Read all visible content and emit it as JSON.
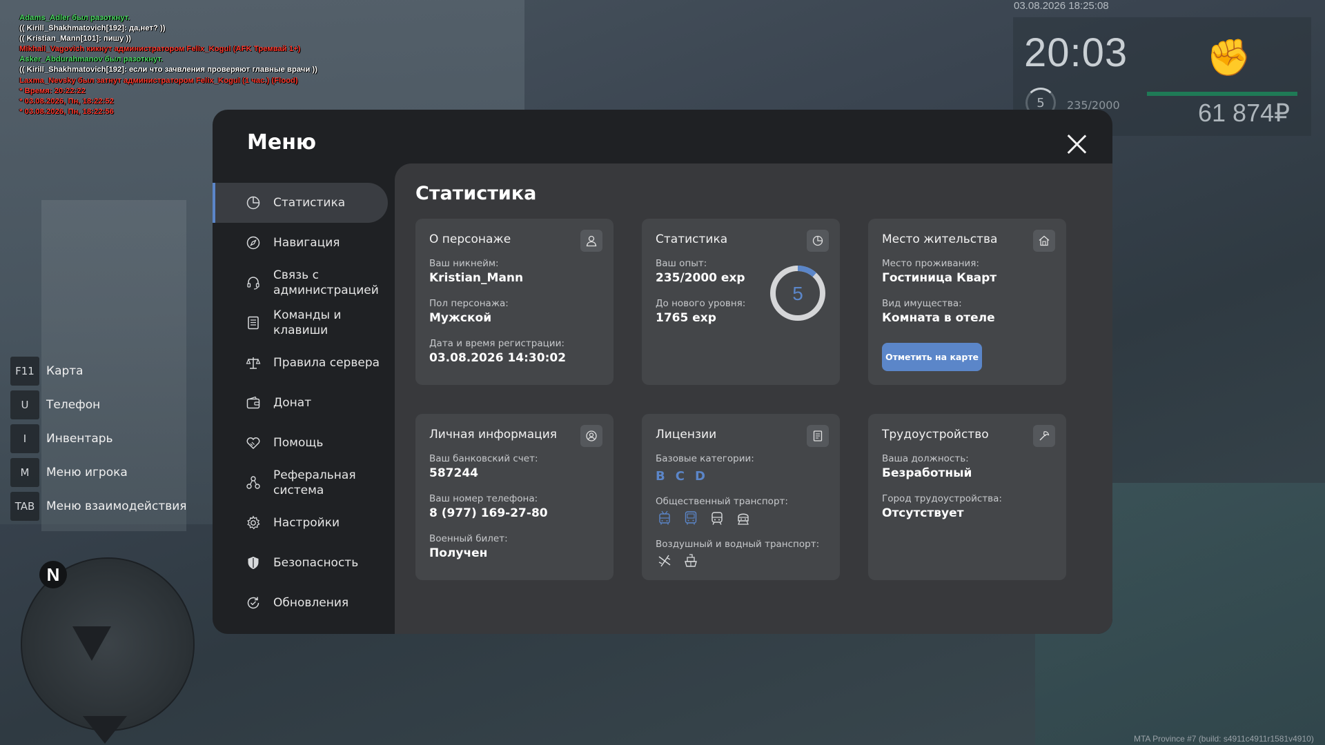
{
  "chat": [
    {
      "text": "Adams_Adler был разоткнут.",
      "color": "#4cd964"
    },
    {
      "text": "(( Kirill_Shakhmatovich[192]: да,нет? ))",
      "color": "#ffffff"
    },
    {
      "text": "(( Kristian_Mann[101]: пишу ))",
      "color": "#ffffff"
    },
    {
      "text": "Mikhail_Vagovich кикнут администратором Felix_Kogul (AFK Тремвай 1+)",
      "color": "#ff3b30"
    },
    {
      "text": "Asker_Abdurahmanov был разоткнут.",
      "color": "#4cd964"
    },
    {
      "text": "(( Kirill_Shakhmatovich[192]: если что зачвления проверяют главные врачи ))",
      "color": "#ffffff"
    },
    {
      "text": "Laxma_Nevsky был затнут администратором Felix_Kogul (1 час.) (Flood)",
      "color": "#ff3b30"
    },
    {
      "text": "* Время: 20:22:22",
      "color": "#ff3b30"
    },
    {
      "text": "* 03.08.2026, Пн, 18:22:52",
      "color": "#ff3b30"
    },
    {
      "text": "* 03.08.2026, Пн, 18:22:56",
      "color": "#ff3b30"
    }
  ],
  "hud": {
    "datetime": "03.08.2026 18:25:08",
    "clock": "20:03",
    "level": "5",
    "exp": "235/2000",
    "money": "61 874₽",
    "fist_icon": "fist-icon"
  },
  "hotkeys": [
    {
      "key": "F11",
      "label": "Карта"
    },
    {
      "key": "U",
      "label": "Телефон"
    },
    {
      "key": "I",
      "label": "Инвентарь"
    },
    {
      "key": "M",
      "label": "Меню игрока"
    },
    {
      "key": "TAB",
      "label": "Меню взаимодействия"
    }
  ],
  "minimap": {
    "north": "N"
  },
  "build": "MTA Province #7 (build: s4911c4911r1581v4910)",
  "menu": {
    "title": "Меню",
    "sidebar": [
      {
        "label": "Статистика",
        "icon": "chart-pie-icon",
        "active": true
      },
      {
        "label": "Навигация",
        "icon": "compass-icon"
      },
      {
        "label": "Связь с администрацией",
        "icon": "headset-icon"
      },
      {
        "label": "Команды и клавиши",
        "icon": "document-list-icon"
      },
      {
        "label": "Правила сервера",
        "icon": "scales-icon"
      },
      {
        "label": "Донат",
        "icon": "wallet-icon"
      },
      {
        "label": "Помощь",
        "icon": "handshake-icon"
      },
      {
        "label": "Реферальная система",
        "icon": "referral-icon"
      },
      {
        "label": "Настройки",
        "icon": "gear-icon"
      },
      {
        "label": "Безопасность",
        "icon": "shield-icon"
      },
      {
        "label": "Обновления",
        "icon": "refresh-icon"
      }
    ],
    "content_title": "Статистика",
    "cards": {
      "character": {
        "title": "О персонаже",
        "nick_label": "Ваш никнейм:",
        "nick": "Kristian_Mann",
        "gender_label": "Пол персонажа:",
        "gender": "Мужской",
        "reg_label": "Дата и время регистрации:",
        "reg": "03.08.2026 14:30:02"
      },
      "stats": {
        "title": "Статистика",
        "exp_label": "Ваш опыт:",
        "exp": "235/2000 exp",
        "next_label": "До нового уровня:",
        "next": "1765 exp",
        "level": "5",
        "progress": 0.1175
      },
      "residence": {
        "title": "Место жительства",
        "place_label": "Место проживания:",
        "place": "Гостиница Кварт",
        "type_label": "Вид имущества:",
        "type": "Комната в отеле",
        "button": "Отметить на карте"
      },
      "personal": {
        "title": "Личная информация",
        "bank_label": "Ваш банковский счет:",
        "bank": "587244",
        "phone_label": "Ваш номер телефона:",
        "phone": "8 (977) 169-27-80",
        "military_label": "Военный билет:",
        "military": "Получен"
      },
      "licenses": {
        "title": "Лицензии",
        "base_label": "Базовые категории:",
        "base": [
          "B",
          "C",
          "D"
        ],
        "public_label": "Общественный транспорт:",
        "public_icons": [
          "trolleybus-icon",
          "bus-icon",
          "tram-icon",
          "train-icon"
        ],
        "air_label": "Воздушный и водный транспорт:",
        "air_icons": [
          "plane-icon",
          "ship-icon"
        ]
      },
      "employment": {
        "title": "Трудоустройство",
        "job_label": "Ваша должность:",
        "job": "Безработный",
        "city_label": "Город трудоустройства:",
        "city": "Отсутствует"
      }
    }
  },
  "colors": {
    "accent": "#5b86c9",
    "panel": "#1f2124",
    "card": "#444649"
  }
}
